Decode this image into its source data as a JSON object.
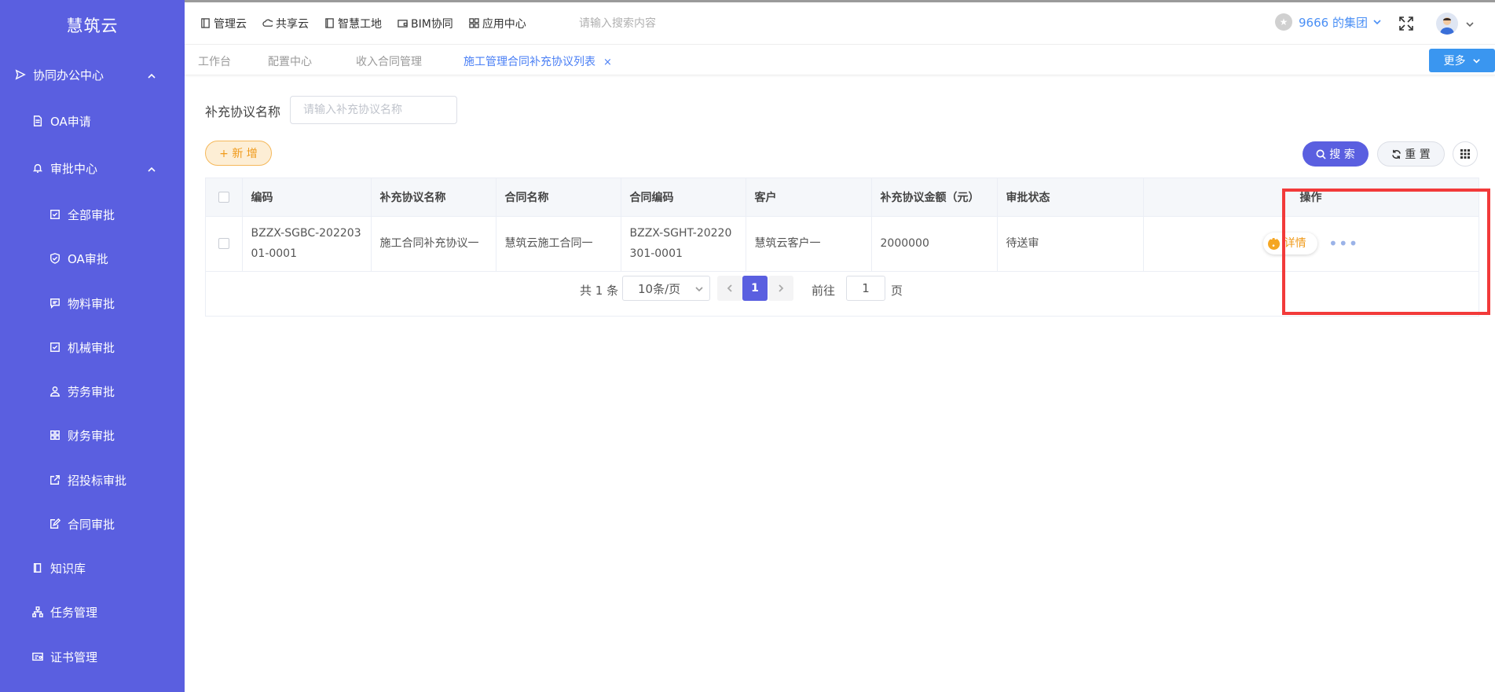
{
  "sidebar": {
    "logo": "慧筑云",
    "items": [
      {
        "label": "协同办公中心",
        "name": "sidebar-item-collab-office",
        "icon": "send-icon",
        "level": 0,
        "expanded": true
      },
      {
        "label": "OA申请",
        "name": "sidebar-item-oa-apply",
        "icon": "document-icon",
        "level": 1
      },
      {
        "label": "审批中心",
        "name": "sidebar-item-approval-center",
        "icon": "bell-icon",
        "level": 1,
        "expanded": true
      },
      {
        "label": "全部审批",
        "name": "sidebar-item-all-approval",
        "icon": "checkbox-icon",
        "level": 2
      },
      {
        "label": "OA审批",
        "name": "sidebar-item-oa-approval",
        "icon": "shield-check-icon",
        "level": 2
      },
      {
        "label": "物料审批",
        "name": "sidebar-item-material-approval",
        "icon": "message-icon",
        "level": 2
      },
      {
        "label": "机械审批",
        "name": "sidebar-item-machinery-approval",
        "icon": "checkbox-icon",
        "level": 2
      },
      {
        "label": "劳务审批",
        "name": "sidebar-item-labor-approval",
        "icon": "user-icon",
        "level": 2
      },
      {
        "label": "财务审批",
        "name": "sidebar-item-finance-approval",
        "icon": "grid-icon",
        "level": 2
      },
      {
        "label": "招投标审批",
        "name": "sidebar-item-bidding-approval",
        "icon": "external-link-icon",
        "level": 2
      },
      {
        "label": "合同审批",
        "name": "sidebar-item-contract-approval",
        "icon": "edit-document-icon",
        "level": 2
      },
      {
        "label": "知识库",
        "name": "sidebar-item-knowledge-base",
        "icon": "book-icon",
        "level": 1
      },
      {
        "label": "任务管理",
        "name": "sidebar-item-task-management",
        "icon": "org-chart-icon",
        "level": 1
      },
      {
        "label": "证书管理",
        "name": "sidebar-item-certificate-management",
        "icon": "certificate-icon",
        "level": 1
      }
    ]
  },
  "topnav": {
    "items": [
      {
        "label": "管理云",
        "name": "nav-management-cloud",
        "icon": "tablet-icon"
      },
      {
        "label": "共享云",
        "name": "nav-shared-cloud",
        "icon": "cloud-icon"
      },
      {
        "label": "智慧工地",
        "name": "nav-smart-site",
        "icon": "book-icon"
      },
      {
        "label": "BIM协同",
        "name": "nav-bim-collab",
        "icon": "wallet-icon"
      },
      {
        "label": "应用中心",
        "name": "nav-app-center",
        "icon": "grid-icon"
      }
    ],
    "search_placeholder": "请输入搜索内容",
    "org_name": "9666 的集团"
  },
  "tabs": {
    "items": [
      {
        "label": "工作台",
        "active": false
      },
      {
        "label": "配置中心",
        "active": false
      },
      {
        "label": "收入合同管理",
        "active": false
      },
      {
        "label": "施工管理合同补充协议列表",
        "active": true
      }
    ],
    "close_glyph": "×",
    "more_label": "更多"
  },
  "filter": {
    "label": "补充协议名称",
    "placeholder": "请输入补充协议名称",
    "value": ""
  },
  "toolbar": {
    "add_label": "+ 新 增",
    "search_label": "搜 索",
    "reset_label": "重 置"
  },
  "table": {
    "headers": [
      "编码",
      "补充协议名称",
      "合同名称",
      "合同编码",
      "客户",
      "补充协议金额（元）",
      "审批状态",
      "操作"
    ],
    "rows": [
      {
        "code": "BZZX-SGBC-20220301-0001",
        "agreement_name": "施工合同补充协议一",
        "contract_name": "慧筑云施工合同一",
        "contract_code": "BZZX-SGHT-20220301-0001",
        "customer": "慧筑云客户一",
        "amount": "2000000",
        "status": "待送审",
        "detail_label": "详情",
        "more_glyph": "•••"
      }
    ]
  },
  "pagination": {
    "total_text": "共 1 条",
    "page_size": "10条/页",
    "current_page": "1",
    "goto_label": "前往",
    "goto_value": "1",
    "unit_label": "页"
  },
  "colors": {
    "sidebar_bg": "#5a5fe0",
    "primary": "#5a5fe0",
    "accent_blue": "#3a96f0",
    "orange": "#f09a1a",
    "highlight_red": "#f23a3a"
  }
}
